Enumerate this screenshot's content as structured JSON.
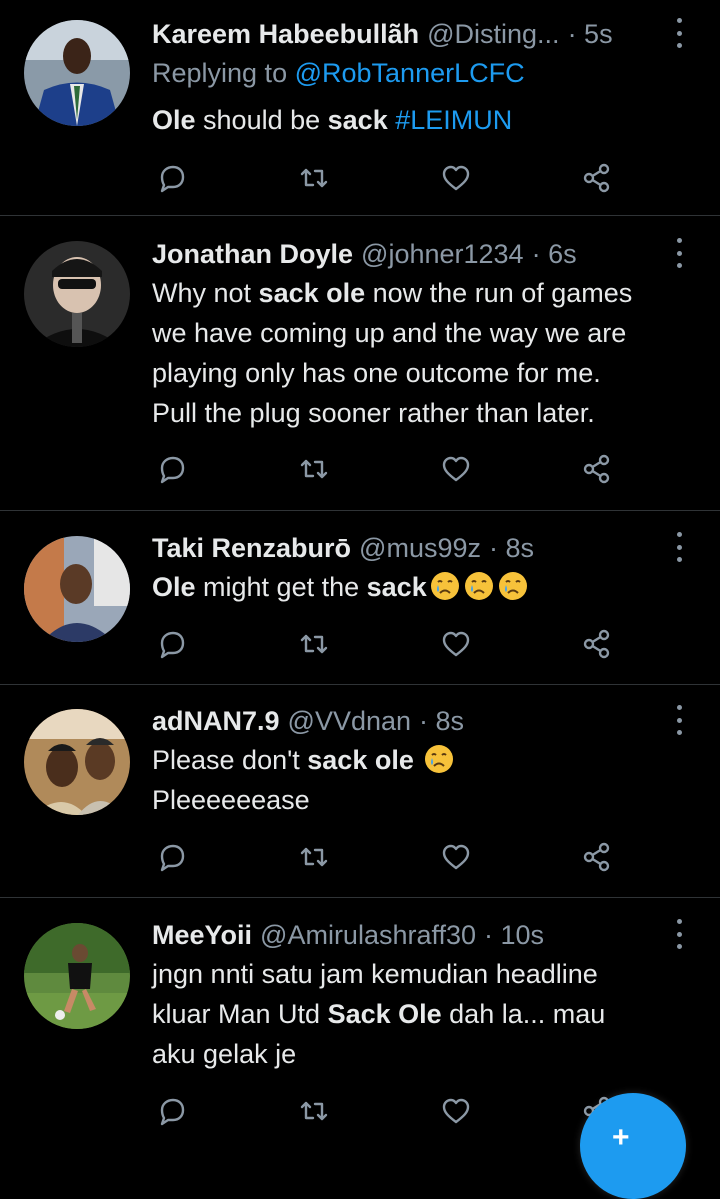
{
  "tweets": [
    {
      "name": "Kareem Habeebullãh",
      "handle": "@Disting...",
      "time": "· 5s",
      "replying_prefix": "Replying to ",
      "replying_to": "@RobTannerLCFC",
      "text_parts": [
        "Ole",
        " should be ",
        "sack",
        " ",
        "#LEIMUN"
      ]
    },
    {
      "name": "Jonathan Doyle",
      "handle": "@johner1234",
      "time": "· 6s",
      "lines": [
        [
          "Why not ",
          "sack ole",
          " now the run of games"
        ],
        "we have coming up and the way we are",
        "playing only has one outcome for me.",
        "Pull the plug sooner rather than later."
      ]
    },
    {
      "name": "Taki Renzaburō",
      "handle": "@mus99z",
      "time": "· 8s",
      "text_parts": [
        "Ole",
        " might get the ",
        "sack"
      ],
      "emoji": [
        "crying-face-emoji",
        "crying-face-emoji",
        "crying-face-emoji"
      ]
    },
    {
      "name": "adNAN7.9",
      "handle": "@VVdnan",
      "time": "· 8s",
      "text_parts": [
        "Please don't ",
        "sack ole"
      ],
      "emoji": [
        "crying-face-emoji"
      ],
      "line2": "Pleeeeeease"
    },
    {
      "name": "MeeYoii",
      "handle": "@Amirulashraff30",
      "time": "· 10s",
      "lines": [
        "jngn nnti satu jam kemudian headline",
        [
          "kluar Man Utd ",
          "Sack Ole",
          " dah la... mau"
        ],
        "aku gelak je"
      ]
    }
  ],
  "actions": [
    "reply-icon",
    "retweet-icon",
    "like-icon",
    "share-icon"
  ],
  "colors": {
    "background": "#000000",
    "text": "#e7e9ea",
    "muted": "#8b98a5",
    "accent": "#1d9bf0",
    "divider": "#2f3336"
  },
  "fab": {
    "plus": "+"
  }
}
